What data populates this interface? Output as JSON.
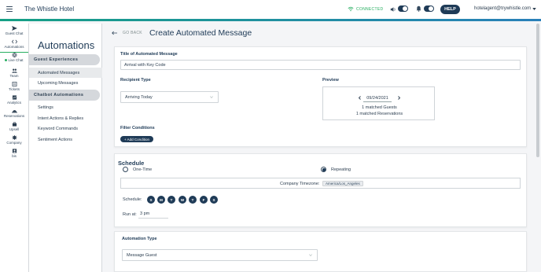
{
  "header": {
    "brand": "The Whistle Hotel",
    "connection_status": "CONNECTED",
    "help_label": "HELP",
    "user_email": "hotelagent@trywhistle.com",
    "accent_color": "#1f3b57",
    "status_color": "#27ae60"
  },
  "rail": {
    "items": [
      {
        "label": "Guest Chat",
        "icon": "paper-plane-icon"
      },
      {
        "label": "Automations",
        "icon": "code-icon"
      },
      {
        "label": "Live Chat",
        "icon": "globe-icon"
      },
      {
        "label": "Team",
        "icon": "team-icon"
      },
      {
        "label": "Tickets",
        "icon": "ticket-icon"
      },
      {
        "label": "Analytics",
        "icon": "analytics-icon"
      },
      {
        "label": "Reservations",
        "icon": "reservations-icon"
      },
      {
        "label": "Upsell",
        "icon": "upsell-icon"
      },
      {
        "label": "Company",
        "icon": "gear-icon"
      },
      {
        "label": "bis",
        "icon": "user-icon"
      }
    ]
  },
  "subnav": {
    "title": "Automations",
    "sections": [
      {
        "heading": "Guest Experiences",
        "links": [
          "Automated Messages",
          "Upcoming Messages"
        ]
      },
      {
        "heading": "Chatbot Automations",
        "links": [
          "Settings",
          "Intent Actions & Replies",
          "Keyword Commands",
          "Sentiment Actions"
        ]
      }
    ]
  },
  "main": {
    "back_label": "GO BACK",
    "title": "Create Automated Message",
    "message_title_label": "Title of Automated Message",
    "message_title_value": "Arrival with Key Code",
    "recipient_label": "Recipient Type",
    "recipient_value": "Arriving Today",
    "preview": {
      "label": "Preview",
      "date": "09/24/2021",
      "matched_guests": "1 matched Guests",
      "matched_reservations": "1 matched Reservations"
    },
    "filter_label": "Filter Conditions",
    "add_condition_label": "+ Add Condition",
    "schedule": {
      "title": "Schedule",
      "one_time_label": "One-Time",
      "repeating_label": "Repeating",
      "selected": "Repeating",
      "timezone_label": "Company Timezone:",
      "timezone_value": "America/Los_Angeles",
      "schedule_label": "Schedule:",
      "days": [
        "S",
        "M",
        "T",
        "W",
        "T",
        "F",
        "S"
      ],
      "run_at_label": "Run at:",
      "run_at_value": "3 pm"
    },
    "automation_type_label": "Automation Type",
    "automation_type_value": "Message Guest"
  }
}
